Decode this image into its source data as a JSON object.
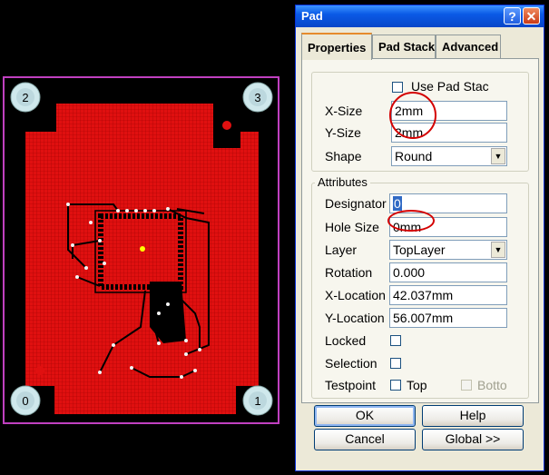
{
  "pcb": {
    "corner_pads": [
      "2",
      "3",
      "0",
      "1"
    ],
    "colors": {
      "board_outline": "#c040c0",
      "copper": "#e01010",
      "trace": "#000000",
      "pad": "#cfe8ec"
    }
  },
  "dialog": {
    "title": "Pad",
    "help_glyph": "?",
    "close_glyph": "✕",
    "tabs": [
      {
        "label": "Properties",
        "active": true
      },
      {
        "label": "Pad Stack",
        "active": false
      },
      {
        "label": "Advanced",
        "active": false
      }
    ],
    "size_group": {
      "use_pad_stack_label": "Use Pad Stac",
      "use_pad_stack_checked": false,
      "x_size_label": "X-Size",
      "x_size_value": "2mm",
      "y_size_label": "Y-Size",
      "y_size_value": "2mm",
      "shape_label": "Shape",
      "shape_value": "Round"
    },
    "attributes": {
      "group_title": "Attributes",
      "designator_label": "Designator",
      "designator_value": "0",
      "hole_size_label": "Hole Size",
      "hole_size_value": "0mm",
      "layer_label": "Layer",
      "layer_value": "TopLayer",
      "rotation_label": "Rotation",
      "rotation_value": "0.000",
      "x_location_label": "X-Location",
      "x_location_value": "42.037mm",
      "y_location_label": "Y-Location",
      "y_location_value": "56.007mm",
      "locked_label": "Locked",
      "selection_label": "Selection",
      "testpoint_label": "Testpoint",
      "top_label": "Top",
      "bottom_label": "Botto"
    },
    "buttons": {
      "ok": "OK",
      "help": "Help",
      "cancel": "Cancel",
      "global": "Global >>"
    }
  }
}
